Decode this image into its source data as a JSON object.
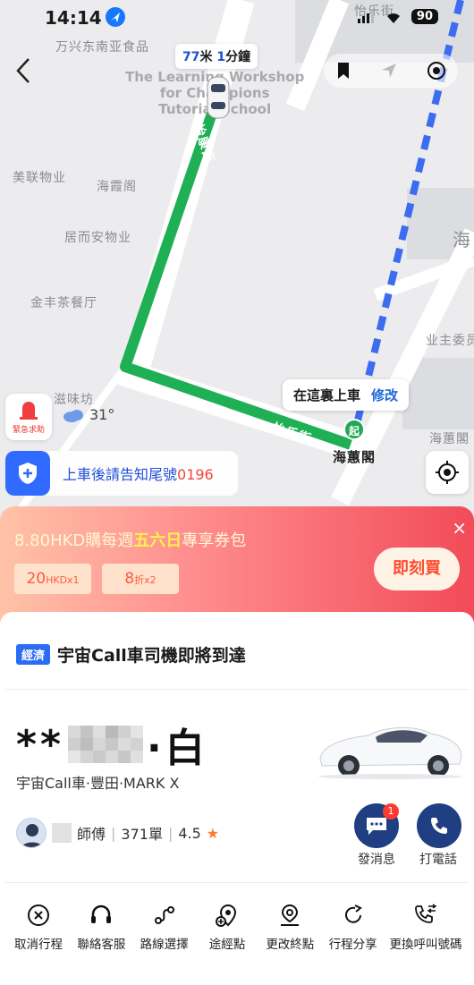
{
  "status_bar": {
    "time": "14:14",
    "battery": "90"
  },
  "map": {
    "eta_distance_num": "77",
    "eta_distance_unit": "米",
    "eta_time_num": "1",
    "eta_time_unit": "分鐘",
    "watermark": [
      "The Learning Workshop",
      "for Champions",
      "Tutorial School"
    ],
    "pois": [
      "万兴东南亚食品",
      "美联物业",
      "海霞阁",
      "居而安物业",
      "金丰茶餐厅",
      "滋味坊",
      "业主委员",
      "海蕙閣",
      "海"
    ],
    "streets": [
      "怡康街",
      "怡乐街",
      "怡乐街"
    ],
    "pickup_label": "在這裏上車",
    "pickup_edit": "修改",
    "start_pin": "起",
    "destination_poi": "海蕙閣"
  },
  "sos_label": "緊急求助",
  "weather_temp": "31°",
  "tail_notice": {
    "prefix": "上車後請告知尾號",
    "number": "0196"
  },
  "promo": {
    "price": "8.80HKD購每週",
    "highlight": "五六日",
    "suffix": "專享券包",
    "coupon1_main": "20",
    "coupon1_small": "HKDx1",
    "coupon2_main": "8",
    "coupon2_small": "折x2",
    "buy": "即刻買",
    "close": "×"
  },
  "trip": {
    "tag": "經濟",
    "status": "宇宙Call車司機即將到達"
  },
  "vehicle": {
    "plate_prefix": "**",
    "plate_suffix": "·白",
    "description": "宇宙Call車·豐田·MARK X"
  },
  "driver": {
    "title": "師傅",
    "orders": "371單",
    "rating": "4.5"
  },
  "actions": {
    "message": "發消息",
    "message_badge": "1",
    "call": "打電話"
  },
  "toolbar": [
    "取消行程",
    "聯絡客服",
    "路線選擇",
    "途經點",
    "更改終點",
    "行程分享",
    "更換呼叫號碼"
  ],
  "colors": {
    "route": "#1fb055",
    "walk": "#3c6cf0",
    "accent": "#1f4fd9",
    "promo_red": "#f24b58"
  }
}
